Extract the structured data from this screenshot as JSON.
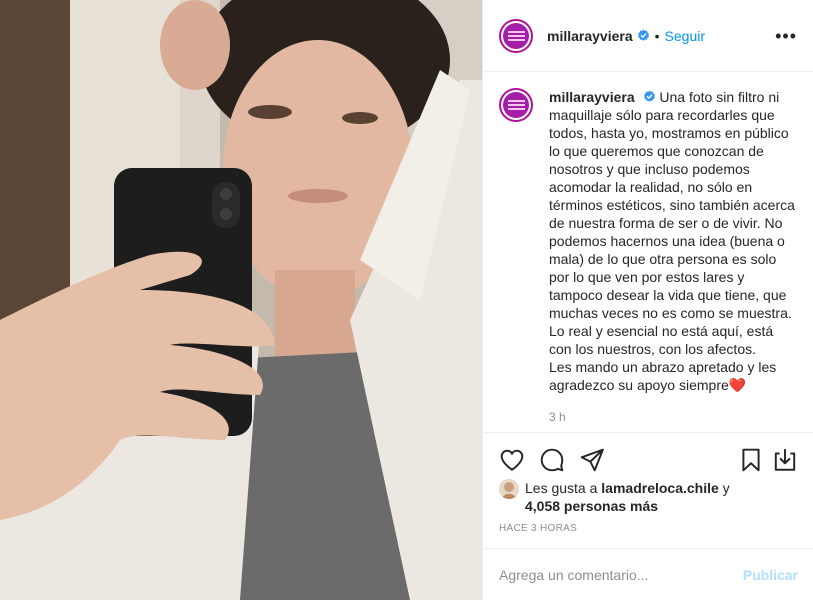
{
  "post": {
    "username": "millarayviera",
    "follow_label": "Seguir",
    "separator": "•",
    "more_label": "•••",
    "caption": "Una foto sin filtro ni maquillaje sólo para recordarles que todos, hasta yo, mostramos en público lo que queremos que conozcan de nosotros y que incluso podemos acomodar la realidad, no sólo en términos estéticos, sino también acerca de nuestra forma de ser o de vivir. No podemos hacernos una idea (buena o mala) de lo que otra persona es solo por lo que ven por estos lares y tampoco desear la vida que tiene, que muchas veces no es como se muestra. Lo real y esencial no está aquí, está con los nuestros, con los afectos.\nLes mando un abrazo apretado y les agradezco su apoyo siempre",
    "caption_emoji": "❤️",
    "caption_time": "3 h",
    "likes_prefix": "Les gusta a ",
    "likes_user": "lamadreloca.chile",
    "likes_mid": " y",
    "likes_count": "4,058 personas más",
    "date": "HACE 3 HORAS"
  },
  "comment": {
    "placeholder": "Agrega un comentario...",
    "publish_label": "Publicar"
  },
  "icons": {
    "like": "heart-icon",
    "comment": "comment-icon",
    "share": "share-icon",
    "save": "bookmark-icon",
    "download": "download-icon",
    "verified": "verified-badge-icon"
  },
  "colors": {
    "accent": "#0095f6",
    "publish_disabled": "#b2dffc",
    "avatar_brand": "#a31fa8",
    "heart": "#ed4956"
  }
}
